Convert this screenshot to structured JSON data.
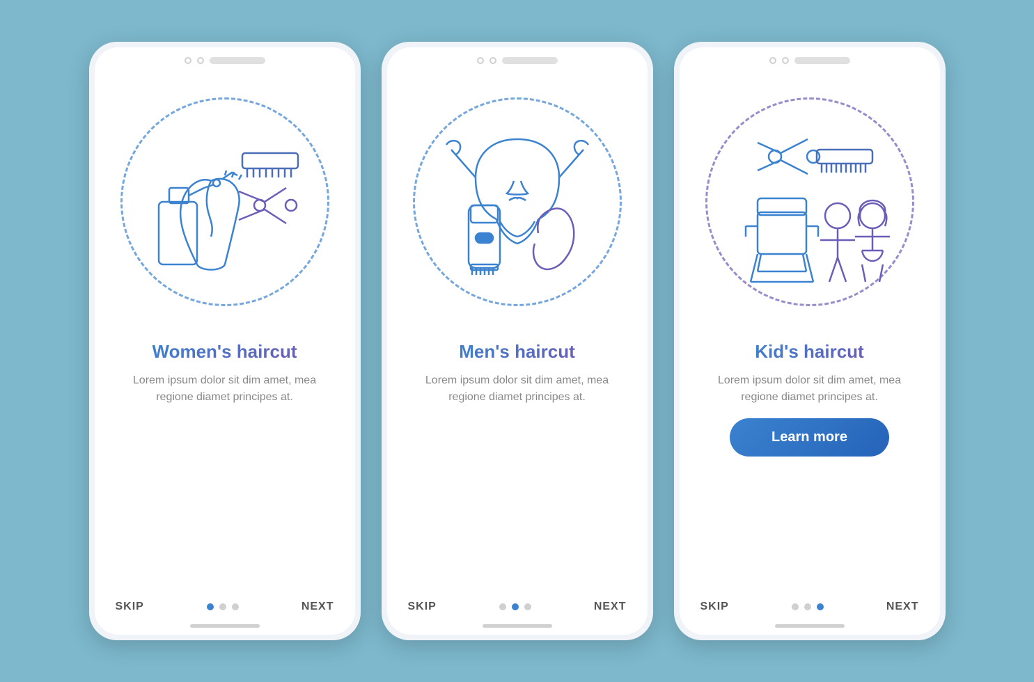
{
  "background_color": "#7db8cc",
  "screens": [
    {
      "id": "womens",
      "title": "Women's haircut",
      "description": "Lorem ipsum dolor sit dim amet, mea regione diamet principes at.",
      "active_dot": 0,
      "has_button": false,
      "button_label": "",
      "skip_label": "SKIP",
      "next_label": "NEXT"
    },
    {
      "id": "mens",
      "title": "Men's haircut",
      "description": "Lorem ipsum dolor sit dim amet, mea regione diamet principes at.",
      "active_dot": 1,
      "has_button": false,
      "button_label": "",
      "skip_label": "SKIP",
      "next_label": "NEXT"
    },
    {
      "id": "kids",
      "title": "Kid's haircut",
      "description": "Lorem ipsum dolor sit dim amet, mea regione diamet principes at.",
      "active_dot": 2,
      "has_button": true,
      "button_label": "Learn more",
      "skip_label": "SKIP",
      "next_label": "NEXT"
    }
  ]
}
